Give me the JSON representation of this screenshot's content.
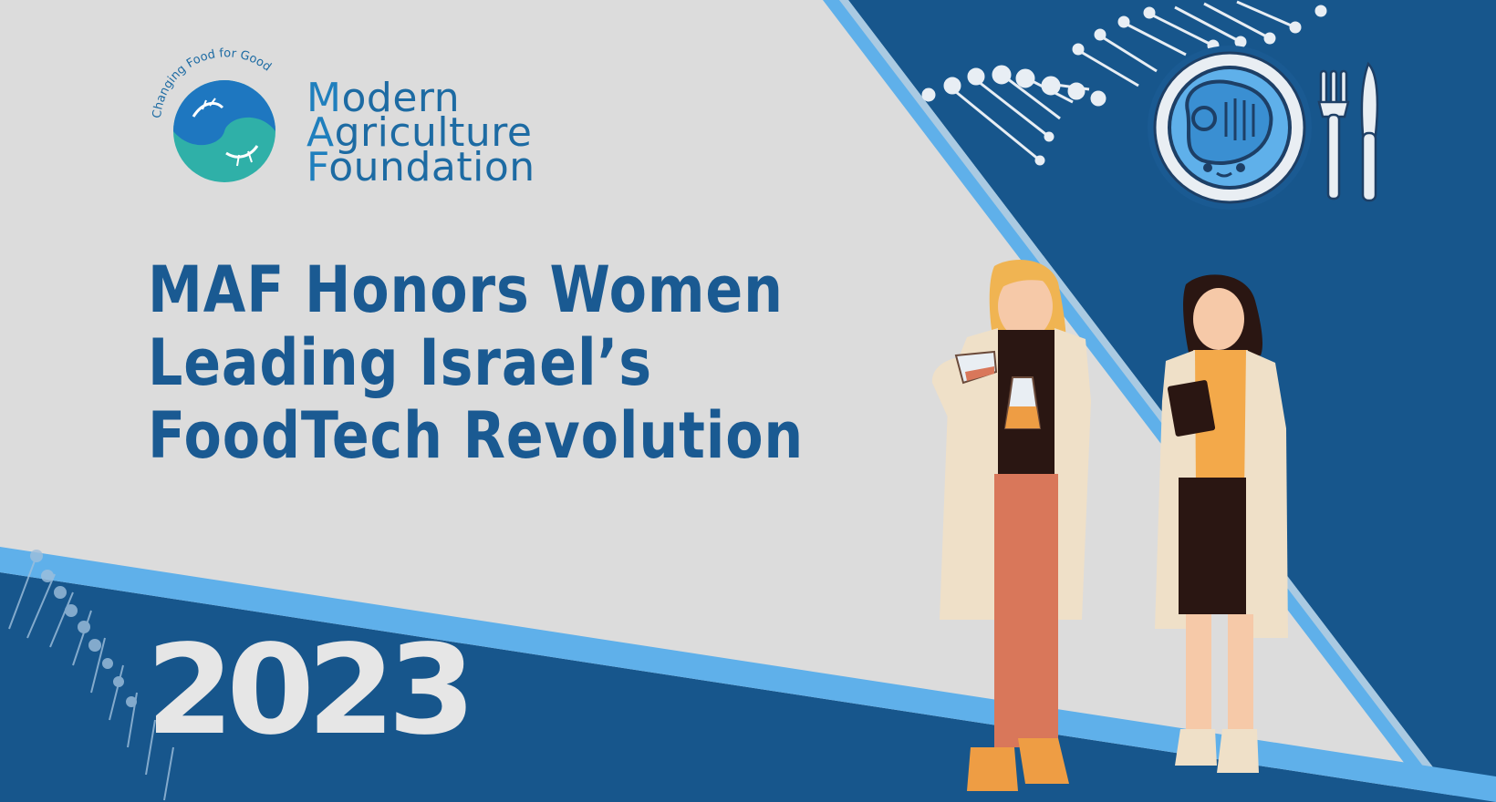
{
  "logo": {
    "tagline": "Changing Food for Good",
    "initials": [
      "M",
      "A",
      "F"
    ],
    "words": [
      "odern",
      "griculture",
      "oundation"
    ]
  },
  "headline": {
    "lines": [
      "MAF Honors Women",
      "Leading Israel’s",
      "FoodTech Revolution"
    ]
  },
  "year": "2023",
  "icons": [
    "dna-helix-icon",
    "plate-with-steak-icon",
    "fork-icon",
    "knife-icon",
    "flask-icon",
    "beaker-icon",
    "notebook-icon"
  ],
  "colors": {
    "background": "#dcdcdc",
    "panel_blue": "#17568c",
    "stripe_light_blue": "#5fb0ea",
    "headline_blue": "#1a5a92",
    "year_white": "#e6e6e6",
    "lab_coat": "#efe0c8",
    "hair_blonde": "#f0b452"
  }
}
